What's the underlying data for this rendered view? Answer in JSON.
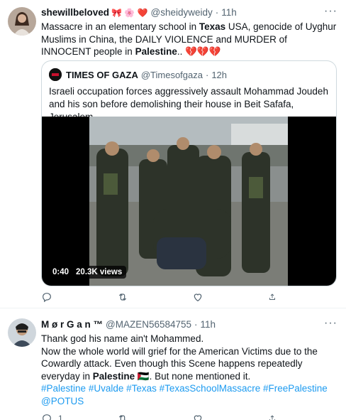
{
  "tweet1": {
    "display_name": "shewillbeloved",
    "name_emoji": "🎀 🌸 ❤️",
    "handle": "@sheidyweidy",
    "separator": "·",
    "time": "11h",
    "more": "···",
    "text_parts": {
      "p1": "Massacre in an elementary school in ",
      "p2_bold": "Texas",
      "p3": " USA, genocide of Uyghur Muslims in China, the DAILY VIOLENCE and MURDER of INNOCENT people in ",
      "p4_bold": "Palestine",
      "p5": ".. 💔💔💔"
    },
    "quote": {
      "name": "TIMES OF GAZA",
      "handle": "@Timesofgaza",
      "separator": "·",
      "time": "12h",
      "text": "Israeli occupation forces aggressively assault Mohammad Joudeh and his son before demolishing their house in Beit Safafa, Jerusalem.",
      "video_time": "0:40",
      "video_views": "20.3K views"
    },
    "actions": {
      "reply": "",
      "retweet": "",
      "like": "",
      "share": ""
    }
  },
  "tweet2": {
    "display_name": "M ø r G a n ™",
    "handle": "@MAZEN56584755",
    "separator": "·",
    "time": "11h",
    "more": "···",
    "line1": "Thank god his name ain't Mohammed.",
    "line2a": "Now the whole world will grief for the American Victims due to the Cowardly attack. Even though this Scene happens repeatedly everyday in ",
    "line2_bold": "Palestine",
    "line2_flag": "🇵🇸",
    "line2b": ". But none mentioned it.",
    "hashtags": [
      "#Palestine",
      "#Uvalde",
      "#Texas",
      "#TexasSchoolMassacre",
      "#FreePalestine"
    ],
    "mention": "@POTUS",
    "actions": {
      "reply": "1",
      "retweet": "",
      "like": "",
      "share": ""
    }
  },
  "colors": {
    "link": "#1d9bf0",
    "muted": "#536471",
    "border": "#cfd9de"
  }
}
